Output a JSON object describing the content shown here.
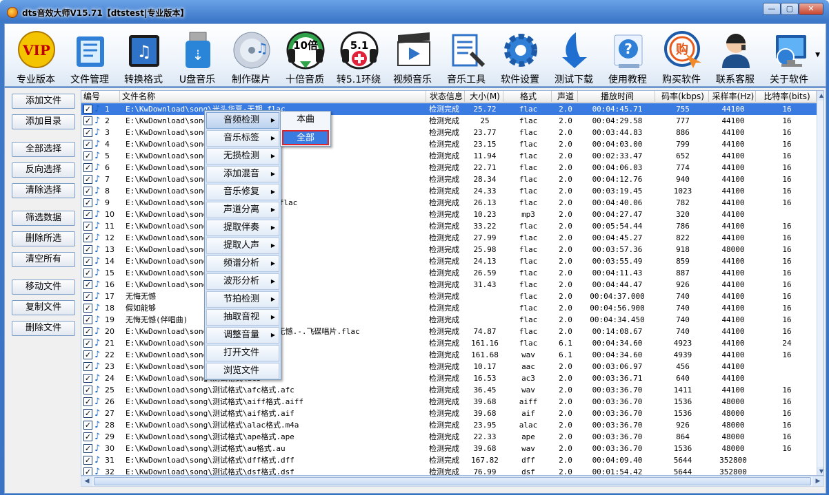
{
  "app": {
    "title": "dts音效大师V15.71【dtstest|专业版本】"
  },
  "window_buttons": [
    "—",
    "▢",
    "✕"
  ],
  "toolbar": [
    {
      "label": "专业版本",
      "icon": "vip-icon"
    },
    {
      "label": "文件管理",
      "icon": "file-manage-icon"
    },
    {
      "label": "转换格式",
      "icon": "convert-format-icon"
    },
    {
      "label": "U盘音乐",
      "icon": "usb-music-icon"
    },
    {
      "label": "制作碟片",
      "icon": "disc-icon"
    },
    {
      "label": "十倍音质",
      "icon": "ten-times-quality-icon",
      "badge": "10倍"
    },
    {
      "label": "转5.1环绕",
      "icon": "surround-51-icon",
      "badge": "5.1"
    },
    {
      "label": "视频音乐",
      "icon": "video-music-icon"
    },
    {
      "label": "音乐工具",
      "icon": "music-tools-icon"
    },
    {
      "label": "软件设置",
      "icon": "settings-gear-icon"
    },
    {
      "label": "测试下载",
      "icon": "download-arrow-icon"
    },
    {
      "label": "使用教程",
      "icon": "help-icon"
    },
    {
      "label": "购买软件",
      "icon": "buy-software-icon",
      "badge": "购"
    },
    {
      "label": "联系客服",
      "icon": "customer-service-icon"
    },
    {
      "label": "关于软件",
      "icon": "about-computer-icon"
    }
  ],
  "left_buttons": [
    "添加文件",
    "添加目录",
    "全部选择",
    "反向选择",
    "清除选择",
    "筛选数据",
    "删除所选",
    "清空所有",
    "移动文件",
    "复制文件",
    "删除文件"
  ],
  "columns": [
    "编号",
    "文件名称",
    "状态信息",
    "大小(M)",
    "格式",
    "声道",
    "播放时间",
    "码率(kbps)",
    "采样率(Hz)",
    "比特率(bits)"
  ],
  "rows": [
    [
      "1",
      "E:\\KwDownload\\song\\光头华夏-无期.flac",
      "检测完成",
      "25.72",
      "flac",
      "2.0",
      "00:04:45.71",
      "755",
      "44100",
      "16"
    ],
    [
      "2",
      "E:\\KwDownload\\song\\",
      "检测完成",
      "25",
      "flac",
      "2.0",
      "00:04:29.58",
      "777",
      "44100",
      "16"
    ],
    [
      "3",
      "E:\\KwDownload\\song\\",
      "检测完成",
      "23.77",
      "flac",
      "2.0",
      "00:03:44.83",
      "886",
      "44100",
      "16"
    ],
    [
      "4",
      "E:\\KwDownload\\song\\",
      "检测完成",
      "23.15",
      "flac",
      "2.0",
      "00:04:03.00",
      "799",
      "44100",
      "16"
    ],
    [
      "5",
      "E:\\KwDownload\\song\\                              c",
      "检测完成",
      "11.94",
      "flac",
      "2.0",
      "00:02:33.47",
      "652",
      "44100",
      "16"
    ],
    [
      "6",
      "E:\\KwDownload\\song\\                              式.flac",
      "检测完成",
      "22.71",
      "flac",
      "2.0",
      "00:04:06.03",
      "774",
      "44100",
      "16"
    ],
    [
      "7",
      "E:\\KwDownload\\song\\",
      "检测完成",
      "28.34",
      "flac",
      "2.0",
      "00:04:12.76",
      "940",
      "44100",
      "16"
    ],
    [
      "8",
      "E:\\KwDownload\\song\\",
      "检测完成",
      "24.33",
      "flac",
      "2.0",
      "00:03:19.45",
      "1023",
      "44100",
      "16"
    ],
    [
      "9",
      "E:\\KwDownload\\song\\                              由比阿且-别知己.flac",
      "检测完成",
      "26.13",
      "flac",
      "2.0",
      "00:04:40.06",
      "782",
      "44100",
      "16"
    ],
    [
      "10",
      "E:\\KwDownload\\song\\                              月夜.mp3",
      "检测完成",
      "10.23",
      "mp3",
      "2.0",
      "00:04:27.47",
      "320",
      "44100",
      ""
    ],
    [
      "11",
      "E:\\KwDownload\\song\\",
      "检测完成",
      "33.22",
      "flac",
      "2.0",
      "00:05:54.44",
      "786",
      "44100",
      "16"
    ],
    [
      "12",
      "E:\\KwDownload\\song\\",
      "检测完成",
      "27.99",
      "flac",
      "2.0",
      "00:04:45.27",
      "822",
      "44100",
      "16"
    ],
    [
      "13",
      "E:\\KwDownload\\song\\                              遇见你.flac",
      "检测完成",
      "25.98",
      "flac",
      "2.0",
      "00:03:57.36",
      "918",
      "48000",
      "16"
    ],
    [
      "14",
      "E:\\KwDownload\\song\\                              .flac",
      "检测完成",
      "24.13",
      "flac",
      "2.0",
      "00:03:55.49",
      "859",
      "44100",
      "16"
    ],
    [
      "15",
      "E:\\KwDownload\\song\\                              打了烊.flac",
      "检测完成",
      "26.59",
      "flac",
      "2.0",
      "00:04:11.43",
      "887",
      "44100",
      "16"
    ],
    [
      "16",
      "E:\\KwDownload\\song\\                              lac",
      "检测完成",
      "31.43",
      "flac",
      "2.0",
      "00:04:44.47",
      "926",
      "44100",
      "16"
    ],
    [
      "17",
      "无悔无憾",
      "检测完成",
      "",
      "flac",
      "2.0",
      "00:04:37.000",
      "740",
      "44100",
      "16"
    ],
    [
      "18",
      "假如能够",
      "检测完成",
      "",
      "flac",
      "2.0",
      "00:04:56.900",
      "740",
      "44100",
      "16"
    ],
    [
      "19",
      "无悔无憾(伴唱曲)",
      "检测完成",
      "",
      "flac",
      "2.0",
      "00:04:34.450",
      "740",
      "44100",
      "16"
    ],
    [
      "20",
      "E:\\KwDownload\\song\\                             2-12-01.-.无悔无憾.-.飞碟唱片.flac",
      "检测完成",
      "74.87",
      "flac",
      "2.0",
      "00:14:08.67",
      "740",
      "44100",
      "16"
    ],
    [
      "21",
      "E:\\KwDownload\\song\\                              .flac",
      "检测完成",
      "161.16",
      "flac",
      "6.1",
      "00:04:34.60",
      "4923",
      "44100",
      "24"
    ],
    [
      "22",
      "E:\\KwDownload\\song\\                              .wav",
      "检测完成",
      "161.68",
      "wav",
      "6.1",
      "00:04:34.60",
      "4939",
      "44100",
      "16"
    ],
    [
      "23",
      "E:\\KwDownload\\song\\                              c",
      "检测完成",
      "10.17",
      "aac",
      "2.0",
      "00:03:06.97",
      "456",
      "44100",
      ""
    ],
    [
      "24",
      "E:\\KwDownload\\song\\测试格式\\ac3",
      "检测完成",
      "16.53",
      "ac3",
      "2.0",
      "00:03:36.71",
      "640",
      "44100",
      ""
    ],
    [
      "25",
      "E:\\KwDownload\\song\\测试格式\\afc格式.afc",
      "检测完成",
      "36.45",
      "wav",
      "2.0",
      "00:03:36.70",
      "1411",
      "44100",
      "16"
    ],
    [
      "26",
      "E:\\KwDownload\\song\\测试格式\\aiff格式.aiff",
      "检测完成",
      "39.68",
      "aiff",
      "2.0",
      "00:03:36.70",
      "1536",
      "48000",
      "16"
    ],
    [
      "27",
      "E:\\KwDownload\\song\\测试格式\\aif格式.aif",
      "检测完成",
      "39.68",
      "aif",
      "2.0",
      "00:03:36.70",
      "1536",
      "48000",
      "16"
    ],
    [
      "28",
      "E:\\KwDownload\\song\\测试格式\\alac格式.m4a",
      "检测完成",
      "23.95",
      "alac",
      "2.0",
      "00:03:36.70",
      "926",
      "48000",
      "16"
    ],
    [
      "29",
      "E:\\KwDownload\\song\\测试格式\\ape格式.ape",
      "检测完成",
      "22.33",
      "ape",
      "2.0",
      "00:03:36.70",
      "864",
      "48000",
      "16"
    ],
    [
      "30",
      "E:\\KwDownload\\song\\测试格式\\au格式.au",
      "检测完成",
      "39.68",
      "wav",
      "2.0",
      "00:03:36.70",
      "1536",
      "48000",
      "16"
    ],
    [
      "31",
      "E:\\KwDownload\\song\\测试格式\\dff格式.dff",
      "检测完成",
      "167.82",
      "dff",
      "2.0",
      "00:04:09.40",
      "5644",
      "352800",
      ""
    ],
    [
      "32",
      "E:\\KwDownload\\song\\测试格式\\dsf格式.dsf",
      "检测完成",
      "76.99",
      "dsf",
      "2.0",
      "00:01:54.42",
      "5644",
      "352800",
      ""
    ]
  ],
  "selected_row": 0,
  "context_menu": [
    "音频检测",
    "音乐标签",
    "无损检测",
    "添加混音",
    "音乐修复",
    "声道分离",
    "提取伴奏",
    "提取人声",
    "频谱分析",
    "波形分析",
    "节拍检测",
    "抽取音视",
    "调整音量",
    "打开文件",
    "浏览文件"
  ],
  "context_menu_has_sub": [
    true,
    true,
    true,
    true,
    true,
    true,
    true,
    true,
    true,
    true,
    true,
    true,
    true,
    false,
    false
  ],
  "submenu": {
    "this": "本曲",
    "all": "全部"
  },
  "colors": {
    "titlebar": "#3d78c9",
    "selection": "#3a7be2",
    "highlight_border": "#e0242a"
  }
}
